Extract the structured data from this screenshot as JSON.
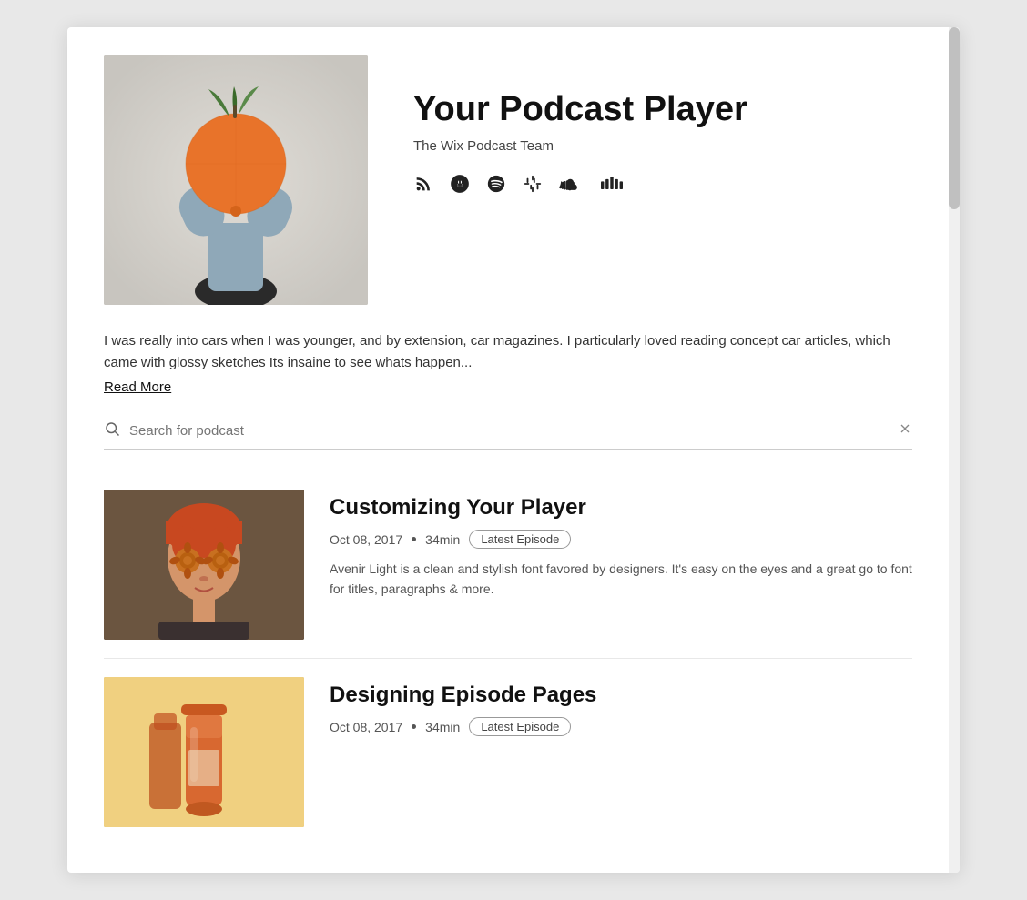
{
  "podcast": {
    "title": "Your Podcast Player",
    "author": "The Wix Podcast Team",
    "description": "I was really into cars when I was younger, and by extension, car magazines. I particularly loved reading concept car articles, which came with glossy sketches Its insaine to see whats happen...",
    "read_more_label": "Read More"
  },
  "icons": {
    "rss": "RSS",
    "apple": "Apple",
    "spotify": "Spotify",
    "google": "Google",
    "soundcloud": "SoundCloud",
    "deezer": "Deezer"
  },
  "search": {
    "placeholder": "Search for podcast"
  },
  "episodes": [
    {
      "title": "Customizing Your Player",
      "date": "Oct 08, 2017",
      "duration": "34min",
      "badge": "Latest Episode",
      "description": "Avenir Light is a clean and stylish font favored by designers. It's easy on the eyes and a great go to font for titles, paragraphs & more."
    },
    {
      "title": "Designing Episode Pages",
      "date": "Oct 08, 2017",
      "duration": "34min",
      "badge": "Latest Episode",
      "description": ""
    }
  ]
}
